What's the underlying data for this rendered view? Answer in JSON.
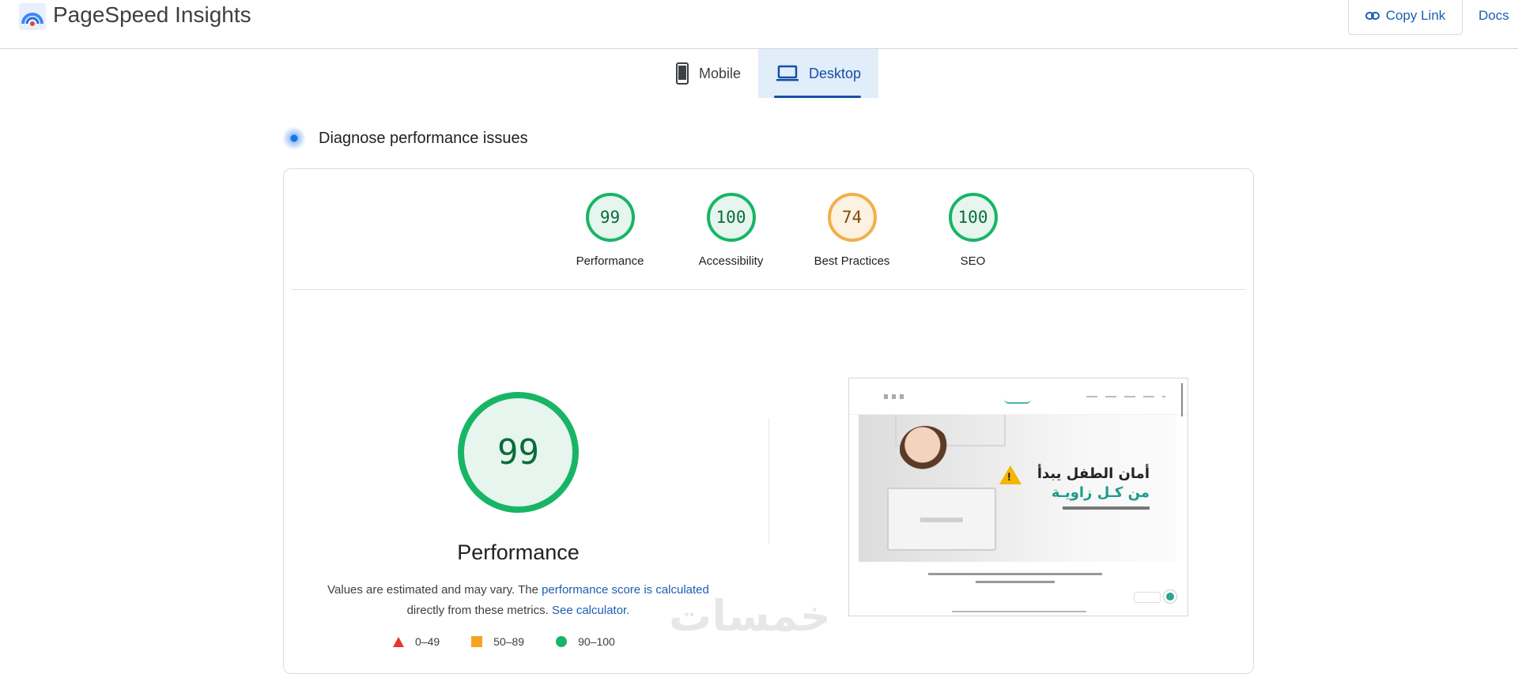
{
  "app": {
    "title": "PageSpeed Insights"
  },
  "header": {
    "copy_link_label": "Copy Link",
    "docs_label": "Docs"
  },
  "tabs": [
    {
      "label": "Mobile",
      "icon": "phone-icon",
      "active": false
    },
    {
      "label": "Desktop",
      "icon": "laptop-icon",
      "active": true
    }
  ],
  "diagnose": {
    "title": "Diagnose performance issues"
  },
  "scores": [
    {
      "label": "Performance",
      "value": "99",
      "status": "pass"
    },
    {
      "label": "Accessibility",
      "value": "100",
      "status": "pass"
    },
    {
      "label": "Best Practices",
      "value": "74",
      "status": "average"
    },
    {
      "label": "SEO",
      "value": "100",
      "status": "pass"
    }
  ],
  "main_score": {
    "value": "99",
    "title": "Performance",
    "desc_prefix": "Values are estimated and may vary. The ",
    "desc_link1": "performance score is calculated",
    "desc_mid": " directly from these metrics. ",
    "desc_link2": "See calculator."
  },
  "legend": [
    {
      "range": "0–49",
      "shape": "triangle",
      "color": "#e8362c"
    },
    {
      "range": "50–89",
      "shape": "square",
      "color": "#f4a524"
    },
    {
      "range": "90–100",
      "shape": "circle",
      "color": "#18b566"
    }
  ],
  "screenshot": {
    "headline1": "أمان الطفل يبدأ",
    "headline2": "من كـل زاويـة"
  },
  "watermark": "خمسات",
  "colors": {
    "pass": "#18b566",
    "average": "#f4a524",
    "fail": "#e8362c",
    "link": "#1a5fb4"
  }
}
